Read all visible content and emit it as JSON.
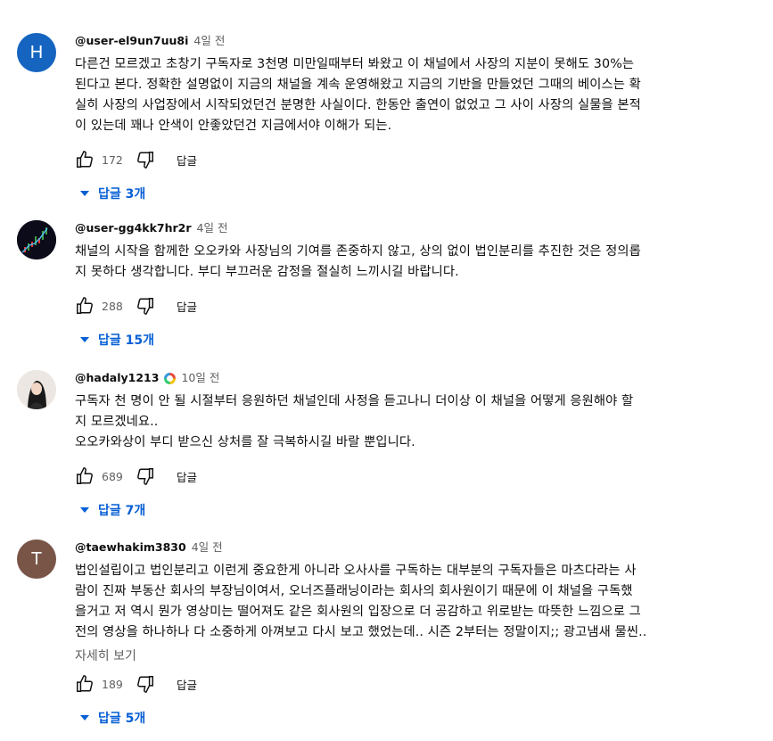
{
  "comments": [
    {
      "avatar_letter": "H",
      "avatar_color": "#1565c0",
      "author": "@user-el9un7uu8i",
      "time": "4일 전",
      "text": "다른건 모르겠고 초창기 구독자로 3천명 미만일때부터 봐왔고 이 채널에서 사장의 지분이 못해도 30%는\n된다고 본다. 정확한 설명없이 지금의 채널을 계속 운영해왔고 지금의 기반을 만들었던 그때의 베이스는 확\n실히 사장의 사업장에서 시작되었던건 분명한 사실이다. 한동안 출연이 없었고 그 사이 사장의 실물을 본적\n이 있는데 꽤나 안색이 안좋았던건 지금에서야 이해가 되는.",
      "likes": "172",
      "reply_label": "답글",
      "replies_label": "답글 3개"
    },
    {
      "avatar_color": "#0b0b1a",
      "author": "@user-gg4kk7hr2r",
      "time": "4일 전",
      "text": "채널의 시작을 함께한 오오카와 사장님의 기여를 존중하지 않고, 상의 없이 법인분리를 추진한 것은 정의롭\n지 못하다 생각합니다. 부디 부끄러운 감정을 절실히 느끼시길 바랍니다.",
      "likes": "288",
      "reply_label": "답글",
      "replies_label": "답글 15개"
    },
    {
      "avatar_color": "#e9e4df",
      "author": "@hadaly1213",
      "time": "10일 전",
      "text": "구독자 천 명이 안 될 시절부터 응원하던 채널인데 사정을 듣고나니 더이상 이 채널을 어떻게 응원해야 할\n지 모르겠네요..\n오오카와상이 부디 받으신 상처를 잘 극복하시길 바랄 뿐입니다.",
      "likes": "689",
      "reply_label": "답글",
      "replies_label": "답글 7개"
    },
    {
      "avatar_letter": "T",
      "avatar_color": "#795548",
      "author": "@taewhakim3830",
      "time": "4일 전",
      "text": "법인설립이고 법인분리고 이런게 중요한게 아니라 오사사를 구독하는 대부분의 구독자들은 마츠다라는 사\n람이 진짜 부동산 회사의 부장님이여서, 오너즈플래닝이라는 회사의 회사원이기 때문에 이 채널을 구독했\n을거고 저 역시 뭔가 영상미는 떨어져도 같은 회사원의 입장으로 더 공감하고 위로받는 따뜻한 느낌으로 그\n전의 영상을 하나하나 다 소중하게 아껴보고 다시 보고 했었는데.. 시즌 2부터는 정말이지;; 광고냄새 물씬..",
      "more_label": "자세히 보기",
      "likes": "189",
      "reply_label": "답글",
      "replies_label": "답글 5개"
    }
  ]
}
